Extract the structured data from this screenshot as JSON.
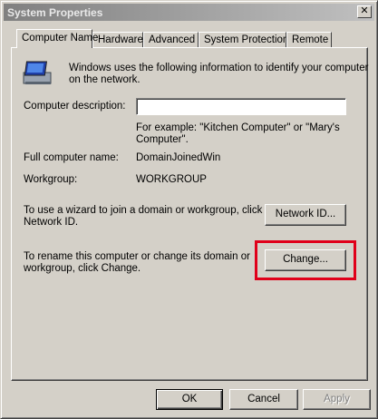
{
  "window": {
    "title": "System Properties",
    "close_glyph": "✕"
  },
  "tabs": [
    {
      "label": "Computer Name"
    },
    {
      "label": "Hardware"
    },
    {
      "label": "Advanced"
    },
    {
      "label": "System Protection"
    },
    {
      "label": "Remote"
    }
  ],
  "intro": {
    "icon": "computer-icon",
    "line1": "Windows uses the following information to identify your computer",
    "line2": "on the network."
  },
  "description": {
    "label": "Computer description:",
    "value": "",
    "example_line1": "For example: \"Kitchen Computer\" or \"Mary's",
    "example_line2": "Computer\"."
  },
  "full_name": {
    "label": "Full computer name:",
    "value": "DomainJoinedWin"
  },
  "workgroup": {
    "label": "Workgroup:",
    "value": "WORKGROUP"
  },
  "network_id": {
    "line1": "To use a wizard to join a domain or workgroup, click",
    "line2": "Network ID.",
    "button": "Network ID..."
  },
  "rename": {
    "line1": "To rename this computer or change its domain or",
    "line2": "workgroup, click Change.",
    "button": "Change..."
  },
  "footer": {
    "ok": "OK",
    "cancel": "Cancel",
    "apply": "Apply"
  },
  "colors": {
    "highlight": "#e0001a",
    "face": "#d4d0c8"
  }
}
